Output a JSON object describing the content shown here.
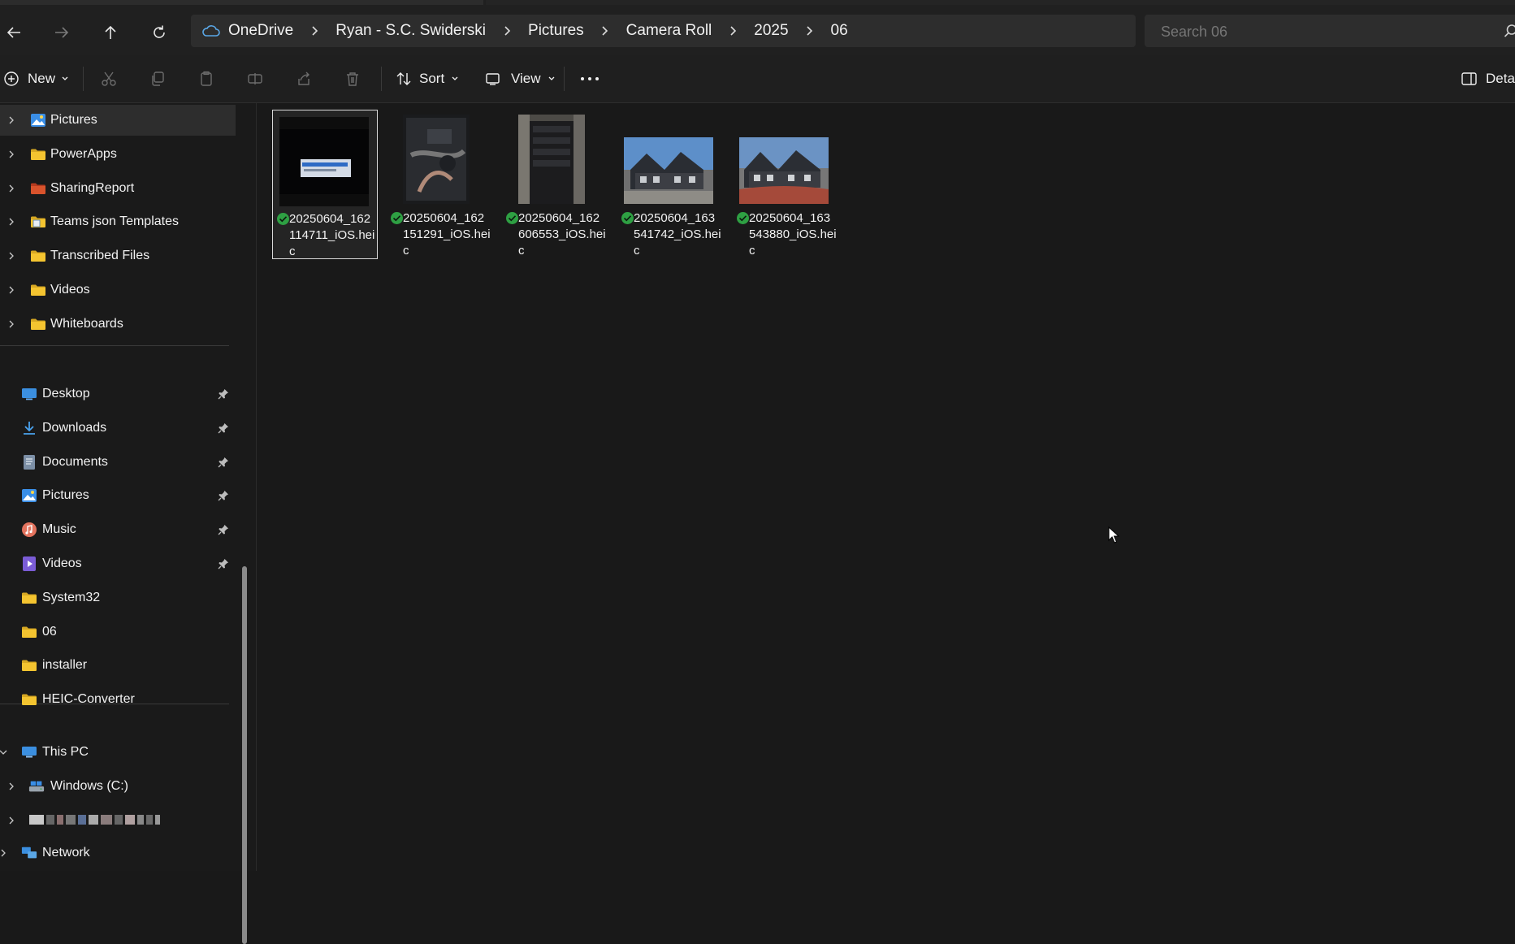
{
  "nav": {
    "back_icon": "arrow-left-icon",
    "forward_icon": "arrow-right-icon",
    "up_icon": "arrow-up-icon",
    "refresh_icon": "refresh-icon"
  },
  "breadcrumb": [
    "OneDrive",
    "Ryan - S.C. Swiderski",
    "Pictures",
    "Camera Roll",
    "2025",
    "06"
  ],
  "search": {
    "placeholder": "Search 06"
  },
  "commandbar": {
    "new_label": "New",
    "sort_label": "Sort",
    "view_label": "View",
    "details_label": "Details"
  },
  "sidebar": {
    "tree_items": [
      {
        "label": "Pictures",
        "icon": "pictures-icon",
        "selected": true
      },
      {
        "label": "PowerApps",
        "icon": "folder-icon"
      },
      {
        "label": "SharingReport",
        "icon": "folder-red-icon"
      },
      {
        "label": "Teams json Templates",
        "icon": "folder-doc-icon"
      },
      {
        "label": "Transcribed Files",
        "icon": "folder-icon"
      },
      {
        "label": "Videos",
        "icon": "folder-icon"
      },
      {
        "label": "Whiteboards",
        "icon": "folder-icon"
      }
    ],
    "quick_access": [
      {
        "label": "Desktop",
        "icon": "desktop-icon",
        "pinned": true
      },
      {
        "label": "Downloads",
        "icon": "download-icon",
        "pinned": true
      },
      {
        "label": "Documents",
        "icon": "documents-icon",
        "pinned": true
      },
      {
        "label": "Pictures",
        "icon": "pictures-icon",
        "pinned": true
      },
      {
        "label": "Music",
        "icon": "music-icon",
        "pinned": true
      },
      {
        "label": "Videos",
        "icon": "videos-icon",
        "pinned": true
      },
      {
        "label": "System32",
        "icon": "folder-icon",
        "pinned": false
      },
      {
        "label": "06",
        "icon": "folder-icon",
        "pinned": false
      },
      {
        "label": "installer",
        "icon": "folder-icon",
        "pinned": false
      },
      {
        "label": "HEIC-Converter",
        "icon": "folder-icon",
        "pinned": false
      }
    ],
    "this_pc": "This PC",
    "windows_drive": "Windows (C:)",
    "network": "Network"
  },
  "files": [
    {
      "name": "20250604_162114711_iOS.heic",
      "line1": "20250604_162",
      "line2": "114711_iOS.hei",
      "line3": "c",
      "selected": true,
      "synced": true
    },
    {
      "name": "20250604_162151291_iOS.heic",
      "line1": "20250604_162",
      "line2": "151291_iOS.hei",
      "line3": "c",
      "selected": false,
      "synced": true
    },
    {
      "name": "20250604_162606553_iOS.heic",
      "line1": "20250604_162",
      "line2": "606553_iOS.hei",
      "line3": "c",
      "selected": false,
      "synced": true
    },
    {
      "name": "20250604_163541742_iOS.heic",
      "line1": "20250604_163",
      "line2": "541742_iOS.hei",
      "line3": "c",
      "selected": false,
      "synced": true
    },
    {
      "name": "20250604_163543880_iOS.heic",
      "line1": "20250604_163",
      "line2": "543880_iOS.hei",
      "line3": "c",
      "selected": false,
      "synced": true
    }
  ],
  "colors": {
    "background": "#191919",
    "chrome": "#202020",
    "folder": "#f4c430",
    "sync_ok": "#2ea043",
    "accent": "#5aa7e6"
  }
}
